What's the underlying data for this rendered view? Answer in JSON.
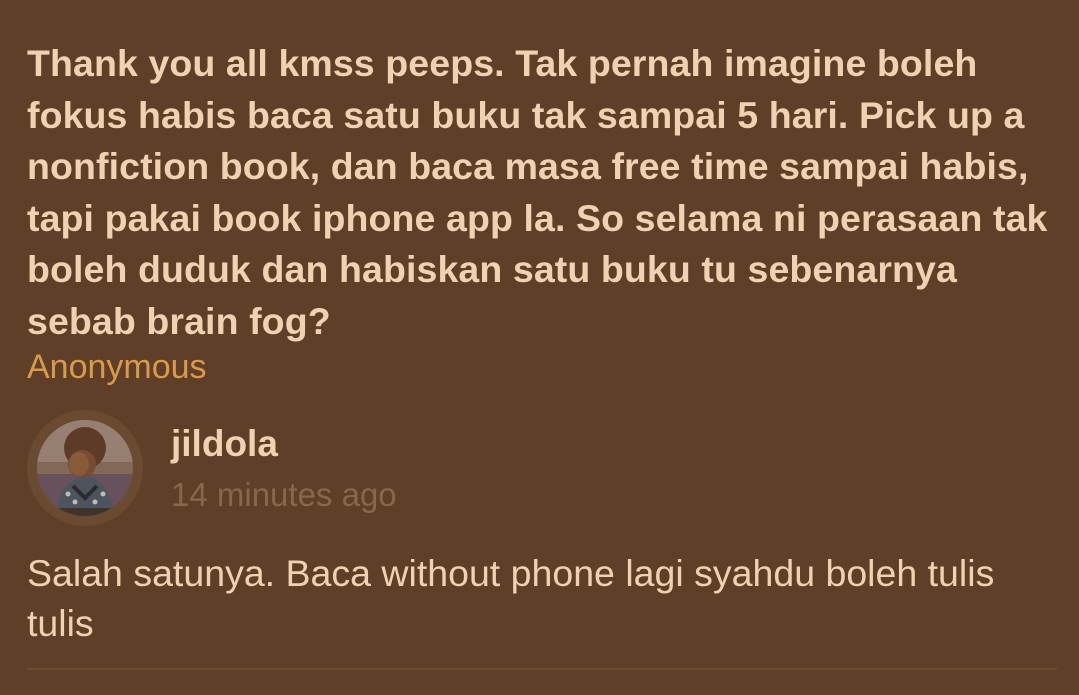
{
  "post": {
    "question": "Thank you all kmss peeps. Tak pernah imagine boleh fokus habis baca satu buku tak sampai 5 hari. Pick up a nonfiction book, dan baca masa free time sampai habis, tapi pakai book iphone app la. So selama ni perasaan tak boleh duduk dan habiskan satu buku tu sebenarnya sebab brain fog?",
    "author": "Anonymous"
  },
  "comment": {
    "username": "jildola",
    "time": "14 minutes ago",
    "text": "Salah satunya. Baca without phone lagi syahdu boleh tulis tulis",
    "avatar": "user-avatar-photo"
  },
  "colors": {
    "background": "#5f3f28",
    "text": "#efd2b2",
    "author_accent": "#d99a4e",
    "muted": "#86684d",
    "divider": "#6d4c34"
  }
}
